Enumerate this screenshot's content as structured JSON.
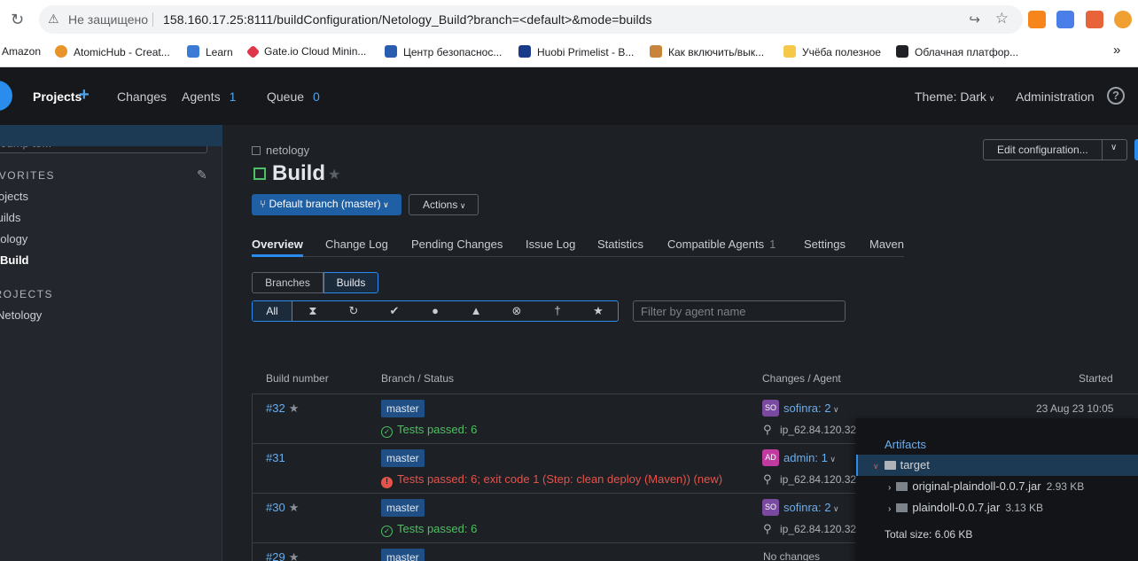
{
  "browser": {
    "insecure_label": "Не защищено",
    "url": "158.160.17.25:8111/buildConfiguration/Netology_Build?branch=<default>&mode=builds",
    "bookmarks": [
      "Amazon",
      "AtomicHub - Creat...",
      "Learn",
      "Gate.io Cloud Minin...",
      "Центр безопаснос...",
      "Huobi Primelist - B...",
      "Как включить/вык...",
      "Учёба полезное",
      "Облачная платфор..."
    ],
    "overflow": "»"
  },
  "header": {
    "projects": "Projects",
    "changes": "Changes",
    "agents": "Agents",
    "agents_count": "1",
    "queue": "Queue",
    "queue_count": "0",
    "theme": "Theme: Dark",
    "administration": "Administration"
  },
  "sidebar": {
    "jump_placeholder": "Jump to...",
    "favorites_heading": "FAVORITES",
    "favorites": [
      "Projects",
      "Builds",
      "Netology",
      "Build"
    ],
    "projects_heading": "PROJECTS",
    "projects": [
      "Netology"
    ]
  },
  "page": {
    "breadcrumb": "netology",
    "title": "Build",
    "edit_config": "Edit configuration...",
    "branch_button": "Default branch (master)",
    "actions_button": "Actions",
    "tabs": [
      "Overview",
      "Change Log",
      "Pending Changes",
      "Issue Log",
      "Statistics",
      "Compatible Agents",
      "Settings",
      "Maven"
    ],
    "compatible_agents_count": "1",
    "view_toggle": [
      "Branches",
      "Builds"
    ],
    "filter_all": "All",
    "agent_filter_placeholder": "Filter by agent name"
  },
  "table": {
    "headers": [
      "Build number",
      "Branch / Status",
      "Changes / Agent",
      "Started"
    ],
    "rows": [
      {
        "number": "#32",
        "starred": true,
        "branch": "master",
        "status": "Tests passed: 6",
        "status_kind": "ok",
        "avatar": "SO",
        "avatar_color": "#7a4aa0",
        "user": "sofinra: 2",
        "agent": "ip_62.84.120.32",
        "started": "23 Aug 23 10:05"
      },
      {
        "number": "#31",
        "starred": false,
        "branch": "master",
        "status": "Tests passed: 6; exit code 1 (Step: clean deploy (Maven)) (new)",
        "status_kind": "error",
        "avatar": "AD",
        "avatar_color": "#c03aa0",
        "user": "admin: 1",
        "agent": "ip_62.84.120.32",
        "started": ""
      },
      {
        "number": "#30",
        "starred": true,
        "branch": "master",
        "status": "Tests passed: 6",
        "status_kind": "ok",
        "avatar": "SO",
        "avatar_color": "#7a4aa0",
        "user": "sofinra: 2",
        "agent": "ip_62.84.120.32",
        "started": ""
      },
      {
        "number": "#29",
        "starred": true,
        "branch": "master",
        "no_changes": "No changes"
      }
    ]
  },
  "artifacts": {
    "title": "Artifacts",
    "folder": "target",
    "files": [
      {
        "name": "original-plaindoll-0.0.7.jar",
        "size": "2.93 KB"
      },
      {
        "name": "plaindoll-0.0.7.jar",
        "size": "3.13 KB"
      }
    ],
    "total": "Total size: 6.06 KB"
  }
}
